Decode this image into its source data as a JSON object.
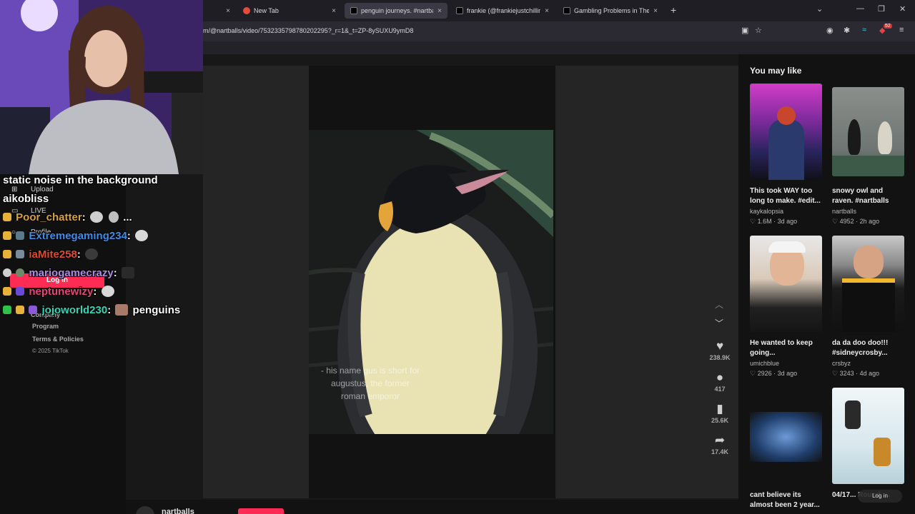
{
  "browser": {
    "tabs": [
      {
        "label": "",
        "active": false
      },
      {
        "label": "New Tab",
        "active": false
      },
      {
        "label": "penguin journeys. #nartball",
        "active": true
      },
      {
        "label": "frankie (@frankiejustchillin)'s vi",
        "active": false
      },
      {
        "label": "Gambling Problems in Therapy",
        "active": false
      }
    ],
    "url": "m/@nartballs/video/7532335798780202295?_r=1&_t=ZP-8ySUXU9ymD8",
    "new_tab_glyph": "+",
    "tab_close_glyph": "×",
    "window_controls": [
      "⌄",
      "—",
      "❐",
      "✕"
    ],
    "notification_badge": "52"
  },
  "sidebar": {
    "items": [
      {
        "label": "Upload",
        "icon": "upload-icon"
      },
      {
        "label": "LIVE",
        "icon": "live-icon"
      },
      {
        "label": "Profile",
        "icon": "profile-icon"
      },
      {
        "label": "Company",
        "icon": ""
      }
    ],
    "login_label": "Log in",
    "footer_program": "Program",
    "footer_terms": "Terms & Policies",
    "copyright": "© 2025 TikTok"
  },
  "video": {
    "caption": "- his name gus is short for augustus, the former roman emporor",
    "author": "nartballs",
    "likes": "238.9K",
    "comments": "417",
    "saves": "25.6K",
    "shares": "17.4K"
  },
  "rail": {
    "title": "You may like",
    "cards": [
      {
        "title": "This took WAY too long to make. #edit...",
        "author": "kaykalopsia",
        "likes": "1.6M",
        "age": "3d ago"
      },
      {
        "title": "snowy owl and raven. #nartballs",
        "author": "nartballs",
        "likes": "4952",
        "age": "2h ago"
      },
      {
        "title": "He wanted to keep going...",
        "author": "umichblue",
        "likes": "2926",
        "age": "3d ago"
      },
      {
        "title": "da da doo doo!!! #sidneycrosby...",
        "author": "crsbyz",
        "likes": "3243",
        "age": "4d ago"
      },
      {
        "title": "cant believe its almost been 2 year...",
        "author": "",
        "likes": "",
        "age": ""
      },
      {
        "title": "04/17... Round, ...",
        "author": "",
        "likes": "",
        "age": ""
      }
    ],
    "float_login": "Log in"
  },
  "chat": {
    "header": "static noise in the background",
    "lines": [
      {
        "user": "aikobliss",
        "message": "",
        "color": "#ffffff"
      },
      {
        "user": "Poor_chatter",
        "message": "...",
        "color": "#d8a23a"
      },
      {
        "user": "Extremegaming234",
        "message": "",
        "color": "#3a8ee8"
      },
      {
        "user": "iaMite258",
        "message": "",
        "color": "#e04a2e"
      },
      {
        "user": "mariogamecrazy",
        "message": "",
        "color": "#b08ae0"
      },
      {
        "user": "neptunewizy",
        "message": "",
        "color": "#e8447a"
      },
      {
        "user": "jojoworld230",
        "message": "penguins",
        "color": "#2ed8b8"
      }
    ]
  },
  "colors": {
    "accent": "#fe2c55",
    "background": "#121212"
  }
}
